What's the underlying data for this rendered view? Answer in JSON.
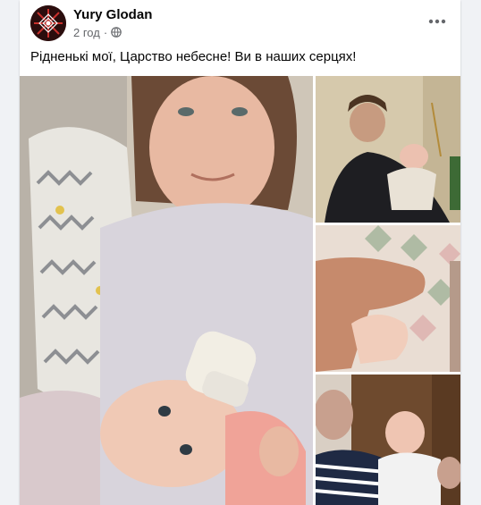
{
  "post": {
    "author": "Yury Glodan",
    "time": "2 год",
    "separator": "·",
    "privacy_icon": "globe-icon",
    "more_icon": "more-horizontal-icon",
    "caption": "Рідненькі мої, Царство небесне! Ви в наших серцях!"
  },
  "colors": {
    "page_bg": "#f0f2f5",
    "card_bg": "#ffffff",
    "name": "#050505",
    "meta": "#65676b"
  },
  "photos": [
    {
      "id": "main",
      "description_icon": "photo-mother-feeding-baby"
    },
    {
      "id": "top-right",
      "description_icon": "photo-man-holding-baby"
    },
    {
      "id": "middle-right",
      "description_icon": "photo-baby-hand"
    },
    {
      "id": "bottom-right",
      "description_icon": "photo-grandmother-with-baby"
    }
  ]
}
